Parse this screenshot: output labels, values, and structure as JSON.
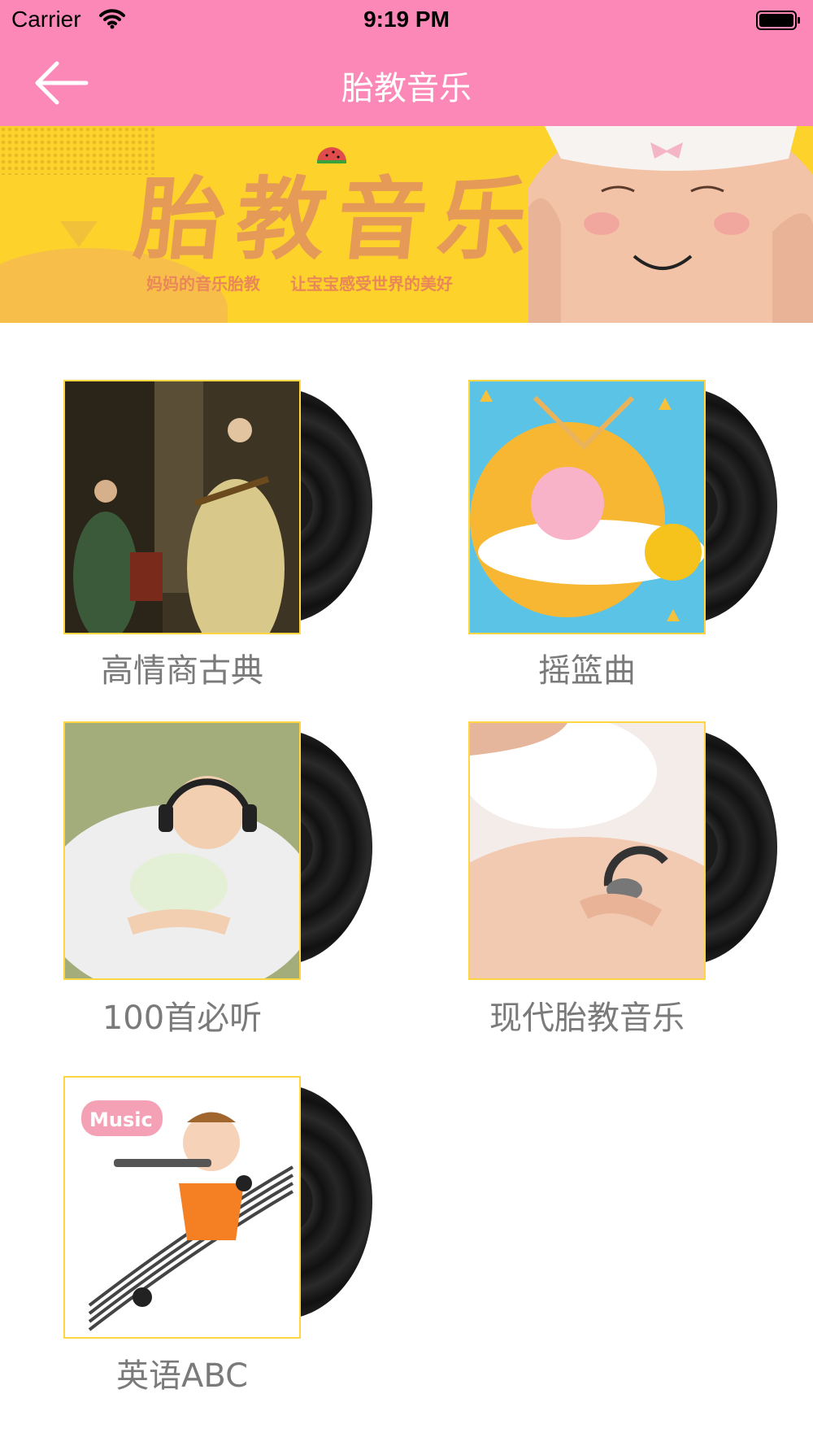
{
  "status_bar": {
    "carrier": "Carrier",
    "time": "9:19 PM",
    "wifi_icon": "wifi-icon",
    "battery_icon": "battery-icon"
  },
  "nav": {
    "title": "胎教音乐",
    "back_icon": "back-arrow-icon",
    "background": "#fb88b7"
  },
  "banner": {
    "title": "胎教音乐",
    "subtitle": "妈妈的音乐胎教 让宝宝感受世界的美好",
    "background": "#fdd22a"
  },
  "albums": [
    {
      "label": "高情商古典",
      "cover_icon": "classical-painting-cover"
    },
    {
      "label": "摇篮曲",
      "cover_icon": "sleeping-cartoon-cover"
    },
    {
      "label": "100首必听",
      "cover_icon": "baby-headphones-cover"
    },
    {
      "label": "现代胎教音乐",
      "cover_icon": "pregnant-headphones-cover"
    },
    {
      "label": "英语ABC",
      "cover_icon": "music-boy-flute-cover"
    }
  ],
  "colors": {
    "cover_border": "#ffd541",
    "label_text": "#7a7a7a"
  }
}
